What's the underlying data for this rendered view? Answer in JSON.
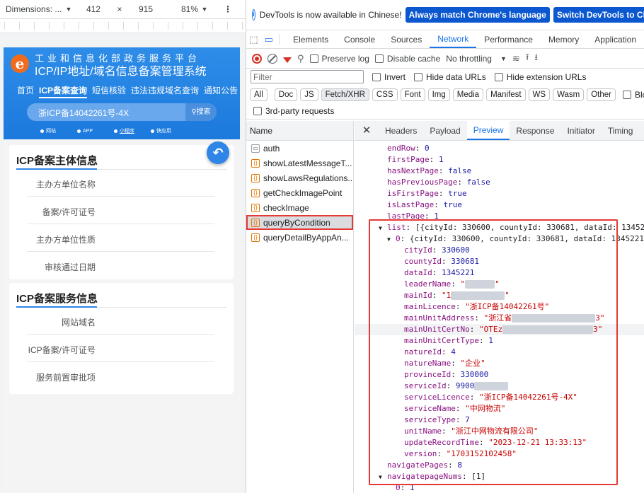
{
  "device_toolbar": {
    "dimensions_label": "Dimensions: ...",
    "width": "412",
    "times": "×",
    "height": "915",
    "zoom": "81%"
  },
  "site": {
    "title_line1": "工业和信息化部政务服务平台",
    "title_line2": "ICP/IP地址/域名信息备案管理系统",
    "nav": [
      "首页",
      "ICP备案查询",
      "短信核验",
      "违法违规域名查询",
      "通知公告"
    ],
    "nav_more": "❯",
    "search_value": "浙ICP备14042261号-4X",
    "search_button": "搜索",
    "mini_nav": [
      "网站",
      "APP",
      "小程序",
      "快应用"
    ],
    "card1": {
      "title": "ICP备案主体信息",
      "rows": [
        "主办方单位名称",
        "备案/许可证号",
        "主办方单位性质",
        "审核通过日期"
      ]
    },
    "card2": {
      "title": "ICP备案服务信息",
      "rows": [
        "网站域名",
        "ICP备案/许可证号",
        "服务前置审批项"
      ]
    }
  },
  "devtools": {
    "infobar": {
      "text": "DevTools is now available in Chinese!",
      "btn_match": "Always match Chrome's language",
      "btn_switch": "Switch DevTools to Chinese"
    },
    "main_tabs": [
      "Elements",
      "Console",
      "Sources",
      "Network",
      "Performance",
      "Memory",
      "Application"
    ],
    "active_main_tab": "Network",
    "toolbar": {
      "preserve_log": "Preserve log",
      "disable_cache": "Disable cache",
      "throttling": "No throttling"
    },
    "filter": {
      "placeholder": "Filter",
      "invert": "Invert",
      "hide_data_urls": "Hide data URLs",
      "hide_extension_urls": "Hide extension URLs"
    },
    "type_filters": [
      "All",
      "Doc",
      "JS",
      "Fetch/XHR",
      "CSS",
      "Font",
      "Img",
      "Media",
      "Manifest",
      "WS",
      "Wasm",
      "Other"
    ],
    "blocked_label": "Blocked",
    "third_party": "3rd-party requests",
    "name_header": "Name",
    "requests": [
      "auth",
      "showLatestMessageT...",
      "showLawsRegulations...",
      "getCheckImagePoint",
      "checkImage",
      "queryByCondition",
      "queryDetailByAppAn..."
    ],
    "selected_request": "queryByCondition",
    "detail_tabs": [
      "Headers",
      "Payload",
      "Preview",
      "Response",
      "Initiator",
      "Timing"
    ],
    "active_detail_tab": "Preview",
    "preview": {
      "endRow": "0",
      "firstPage": "1",
      "hasNextPage": "false",
      "hasPreviousPage": "false",
      "isFirstPage": "true",
      "isLastPage": "true",
      "lastPage": "1",
      "list_summary": "[{cityId: 330600, countyId: 330681, dataId: 13452",
      "item0_summary": "{cityId: 330600, countyId: 330681, dataId: 1345221",
      "cityId": "330600",
      "countyId": "330681",
      "dataId": "1345221",
      "leaderName_visible": "\"",
      "leaderName_end": "\"",
      "mainId_visible": "\"1",
      "mainId_end": "\"",
      "mainLicence": "\"浙ICP备14042261号\"",
      "mainUnitAddress_visible": "\"浙江省",
      "mainUnitAddress_end": "3\"",
      "mainUnitCertNo_visible": "\"OTEz",
      "mainUnitCertNo_end": "3\"",
      "mainUnitCertType": "1",
      "natureId": "4",
      "natureName": "\"企业\"",
      "provinceId": "330000",
      "serviceId_visible": "9900",
      "serviceLicence": "\"浙ICP备14042261号-4X\"",
      "serviceName": "\"中网物流\"",
      "serviceType": "7",
      "unitName": "\"浙江中网物流有限公司\"",
      "updateRecordTime": "\"2023-12-21 13:33:13\"",
      "version": "\"1703152102458\"",
      "navigatePages": "8",
      "navigatepageNums": "[1]",
      "nav0": "1"
    }
  },
  "colors": {
    "site_blue": "#1c79dd",
    "devtools_accent": "#1a73e8",
    "highlight_red": "#e53935"
  }
}
